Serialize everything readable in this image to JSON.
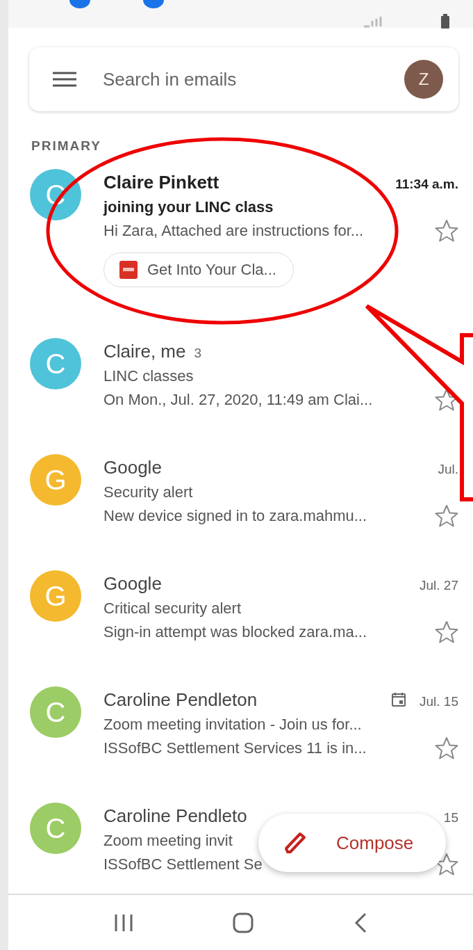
{
  "search": {
    "placeholder": "Search in emails",
    "account_initial": "Z"
  },
  "section": "PRIMARY",
  "emails": [
    {
      "avatar": "C",
      "color": "#4fc3d9",
      "sender": "Claire Pinkett",
      "unread": true,
      "date": "11:34 a.m.",
      "subject": "joining your LINC class",
      "snippet": "Hi Zara, Attached are instructions for...",
      "attachment": "Get Into Your Cla...",
      "starred": false
    },
    {
      "avatar": "C",
      "color": "#4fc3d9",
      "sender": "Claire, me",
      "count": "3",
      "unread": false,
      "subject": "LINC classes",
      "snippet": "On Mon., Jul. 27, 2020, 11:49 am Clai...",
      "starred": false
    },
    {
      "avatar": "G",
      "color": "#f4b92e",
      "sender": "Google",
      "unread": false,
      "date": "Jul.",
      "subject": "Security alert",
      "snippet": "New device signed in to zara.mahmu...",
      "starred": false
    },
    {
      "avatar": "G",
      "color": "#f4b92e",
      "sender": "Google",
      "unread": false,
      "date": "Jul. 27",
      "subject": "Critical security alert",
      "snippet": "Sign-in attempt was blocked zara.ma...",
      "starred": false
    },
    {
      "avatar": "C",
      "color": "#9ccc65",
      "sender": "Caroline Pendleton",
      "unread": false,
      "calendar": true,
      "date": "Jul. 15",
      "subject": "Zoom meeting invitation - Join us for...",
      "snippet": "ISSofBC Settlement Services 11 is in...",
      "starred": false
    },
    {
      "avatar": "C",
      "color": "#9ccc65",
      "sender": "Caroline Pendleto",
      "unread": false,
      "date": "15",
      "subject": "Zoom meeting invit",
      "snippet": "ISSofBC Settlement Se",
      "starred": false
    }
  ],
  "compose": "Compose"
}
